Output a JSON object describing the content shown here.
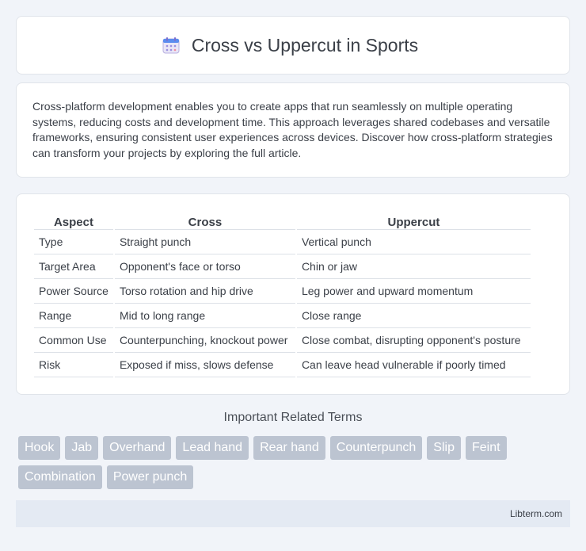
{
  "header": {
    "title": "Cross vs Uppercut in Sports",
    "icon": "calendar-icon"
  },
  "intro": {
    "text": "Cross-platform development enables you to create apps that run seamlessly on multiple operating systems, reducing costs and development time. This approach leverages shared codebases and versatile frameworks, ensuring consistent user experiences across devices. Discover how cross-platform strategies can transform your projects by exploring the full article."
  },
  "table": {
    "headers": [
      "Aspect",
      "Cross",
      "Uppercut"
    ],
    "rows": [
      [
        "Type",
        "Straight punch",
        "Vertical punch"
      ],
      [
        "Target Area",
        "Opponent's face or torso",
        "Chin or jaw"
      ],
      [
        "Power Source",
        "Torso rotation and hip drive",
        "Leg power and upward momentum"
      ],
      [
        "Range",
        "Mid to long range",
        "Close range"
      ],
      [
        "Common Use",
        "Counterpunching, knockout power",
        "Close combat, disrupting opponent's posture"
      ],
      [
        "Risk",
        "Exposed if miss, slows defense",
        "Can leave head vulnerable if poorly timed"
      ]
    ]
  },
  "related": {
    "title": "Important Related Terms",
    "tags": [
      "Hook",
      "Jab",
      "Overhand",
      "Lead hand",
      "Rear hand",
      "Counterpunch",
      "Slip",
      "Feint",
      "Combination",
      "Power punch"
    ]
  },
  "footer": {
    "text": "Libterm.com"
  },
  "colors": {
    "background": "#f1f4f9",
    "tag": "#bcc4d1",
    "footer": "#e4eaf3"
  }
}
